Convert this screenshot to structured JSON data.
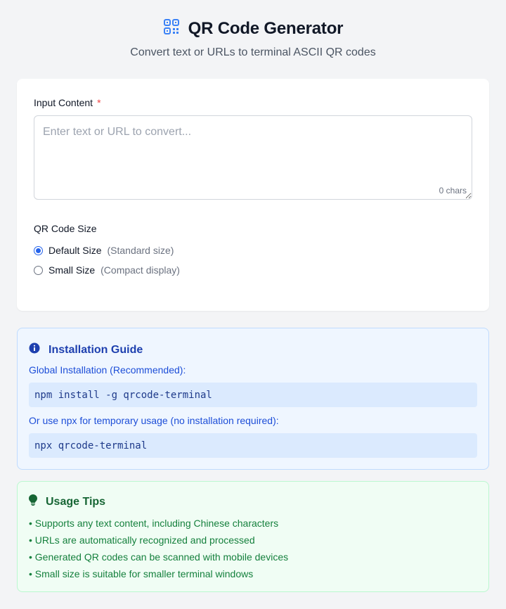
{
  "header": {
    "title": "QR Code Generator",
    "subtitle": "Convert text or URLs to terminal ASCII QR codes",
    "icon": "qr-code-icon",
    "accent_color": "#3b82f6"
  },
  "form": {
    "input_label": "Input Content",
    "required_mark": "*",
    "input_placeholder": "Enter text or URL to convert...",
    "input_value": "",
    "char_count": "0 chars",
    "size_label": "QR Code Size",
    "size_options": [
      {
        "label": "Default Size",
        "hint": "(Standard size)",
        "selected": true
      },
      {
        "label": "Small Size",
        "hint": "(Compact display)",
        "selected": false
      }
    ]
  },
  "guide": {
    "icon": "info-icon",
    "title": "Installation Guide",
    "global_label": "Global Installation (Recommended):",
    "global_cmd": "npm install -g qrcode-terminal",
    "npx_label": "Or use npx for temporary usage (no installation required):",
    "npx_cmd": "npx qrcode-terminal"
  },
  "tips": {
    "icon": "lightbulb-icon",
    "title": "Usage Tips",
    "items": [
      "Supports any text content, including Chinese characters",
      "URLs are automatically recognized and processed",
      "Generated QR codes can be scanned with mobile devices",
      "Small size is suitable for smaller terminal windows"
    ]
  }
}
